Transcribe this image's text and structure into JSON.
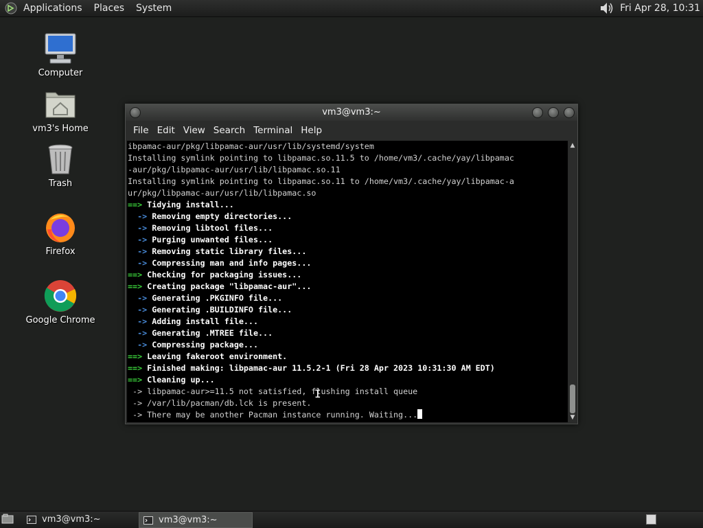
{
  "top_panel": {
    "menus": [
      "Applications",
      "Places",
      "System"
    ],
    "clock": "Fri Apr 28, 10:31"
  },
  "desktop_icons": [
    {
      "label": "Computer",
      "icon": "computer-icon"
    },
    {
      "label": "vm3's Home",
      "icon": "home-folder-icon"
    },
    {
      "label": "Trash",
      "icon": "trash-icon"
    },
    {
      "label": "Firefox",
      "icon": "firefox-icon"
    },
    {
      "label": "Google Chrome",
      "icon": "chrome-icon"
    }
  ],
  "terminal_window": {
    "title": "vm3@vm3:~",
    "menu": [
      "File",
      "Edit",
      "View",
      "Search",
      "Terminal",
      "Help"
    ],
    "lines": [
      {
        "p": "",
        "t": "ibpamac-aur/pkg/libpamac-aur/usr/lib/systemd/system",
        "s": "plain"
      },
      {
        "p": "",
        "t": "Installing symlink pointing to libpamac.so.11.5 to /home/vm3/.cache/yay/libpamac",
        "s": "plain"
      },
      {
        "p": "",
        "t": "-aur/pkg/libpamac-aur/usr/lib/libpamac.so.11",
        "s": "plain"
      },
      {
        "p": "",
        "t": "Installing symlink pointing to libpamac.so.11 to /home/vm3/.cache/yay/libpamac-a",
        "s": "plain"
      },
      {
        "p": "",
        "t": "ur/pkg/libpamac-aur/usr/lib/libpamac.so",
        "s": "plain"
      },
      {
        "p": "==>",
        "t": " Tidying install...",
        "s": "arr"
      },
      {
        "p": "  ->",
        "t": " Removing empty directories...",
        "s": "sarr"
      },
      {
        "p": "  ->",
        "t": " Removing libtool files...",
        "s": "sarr"
      },
      {
        "p": "  ->",
        "t": " Purging unwanted files...",
        "s": "sarr"
      },
      {
        "p": "  ->",
        "t": " Removing static library files...",
        "s": "sarr"
      },
      {
        "p": "  ->",
        "t": " Compressing man and info pages...",
        "s": "sarr"
      },
      {
        "p": "==>",
        "t": " Checking for packaging issues...",
        "s": "arr"
      },
      {
        "p": "==>",
        "t": " Creating package \"libpamac-aur\"...",
        "s": "arr"
      },
      {
        "p": "  ->",
        "t": " Generating .PKGINFO file...",
        "s": "sarr"
      },
      {
        "p": "  ->",
        "t": " Generating .BUILDINFO file...",
        "s": "sarr"
      },
      {
        "p": "  ->",
        "t": " Adding install file...",
        "s": "sarr"
      },
      {
        "p": "  ->",
        "t": " Generating .MTREE file...",
        "s": "sarr"
      },
      {
        "p": "  ->",
        "t": " Compressing package...",
        "s": "sarr"
      },
      {
        "p": "==>",
        "t": " Leaving fakeroot environment.",
        "s": "arr"
      },
      {
        "p": "==>",
        "t": " Finished making: libpamac-aur 11.5.2-1 (Fri 28 Apr 2023 10:31:30 AM EDT)",
        "s": "arr"
      },
      {
        "p": "==>",
        "t": " Cleaning up...",
        "s": "arr"
      },
      {
        "p": "",
        "t": " -> libpamac-aur>=11.5 not satisfied, flushing install queue",
        "s": "plain"
      },
      {
        "p": "",
        "t": " -> /var/lib/pacman/db.lck is present.",
        "s": "plain"
      },
      {
        "p": "",
        "t": " -> There may be another Pacman instance running. Waiting...",
        "s": "plain"
      }
    ]
  },
  "taskbar": {
    "tasks": [
      {
        "label": "vm3@vm3:~",
        "active": false
      },
      {
        "label": "vm3@vm3:~",
        "active": true
      }
    ]
  },
  "colors": {
    "desktop_bg": "#1f211f",
    "prompt_green": "#3ad03a",
    "arrow_blue": "#4a8ede"
  }
}
